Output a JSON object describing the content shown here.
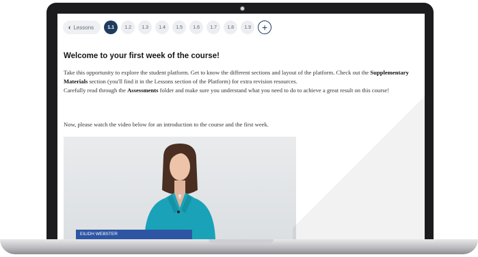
{
  "nav": {
    "back_label": "Lessons",
    "lessons": [
      "1.1",
      "1.2",
      "1.3",
      "1.4",
      "1.5",
      "1.6",
      "1.7",
      "1.8",
      "1.9"
    ],
    "active": "1.1",
    "add_icon": "plus-icon"
  },
  "content": {
    "title": "Welcome to your first week of the course!",
    "p1_a": "Take this opportunity to explore the student platform. Get to know the different sections and layout of the platform. Check out the ",
    "p1_b": "Supplementary Materials",
    "p1_c": " section (you'll find it in the Lessons section of the Platform) for extra revision resources.",
    "p1_d": "Carefully read through the ",
    "p1_e": "Assessments",
    "p1_f": " folder and make sure you understand what you need to do to achieve a great result on this course!",
    "p2": "Now, please watch the video below for an introduction to the course and the first week."
  },
  "video": {
    "caption": "EILIDH WEBSTER",
    "accent": "#2e55a3"
  },
  "colors": {
    "active_pill": "#1f3b5f",
    "bezel": "#1c1c1e"
  }
}
